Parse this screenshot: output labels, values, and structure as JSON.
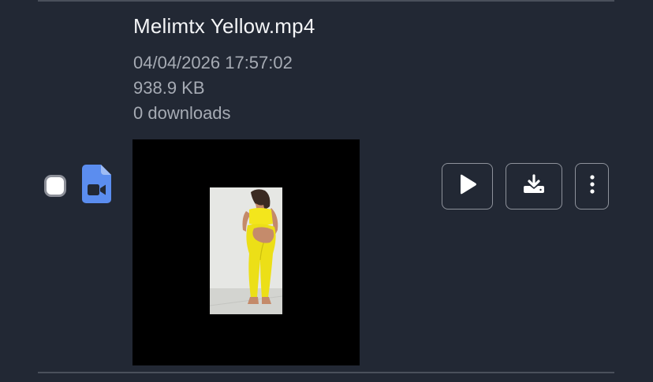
{
  "file": {
    "name": "Melimtx Yellow.mp4",
    "date": "04/04/2026 17:57:02",
    "size": "938.9 KB",
    "downloads": "0 downloads",
    "type_icon": "video-file-icon",
    "selected": false
  },
  "actions": [
    {
      "icon": "play-icon"
    },
    {
      "icon": "download-icon"
    },
    {
      "icon": "more-vertical-icon"
    }
  ],
  "colors": {
    "background": "#222834",
    "accent": "#5b8def",
    "title": "#f4f5f7",
    "meta": "#a6abb4",
    "border": "#8e929b"
  }
}
